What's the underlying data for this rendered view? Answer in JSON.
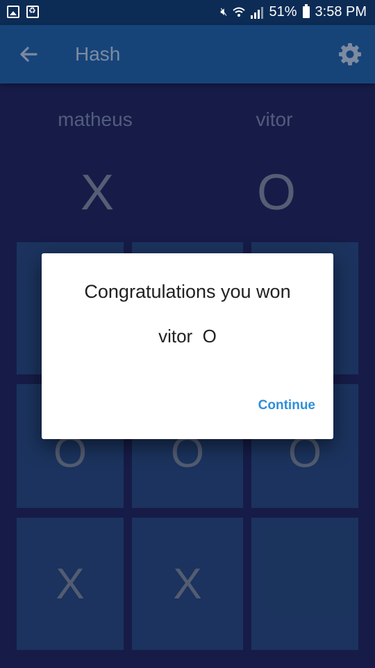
{
  "status_bar": {
    "time": "3:58 PM",
    "battery": "51%",
    "icons": [
      "image-icon",
      "package-icon",
      "mute-icon",
      "wifi-icon",
      "signal-icon",
      "battery-icon"
    ]
  },
  "app_bar": {
    "title": "Hash",
    "back_icon": "arrow-back-icon",
    "settings_icon": "gear-icon"
  },
  "players": [
    {
      "name": "matheus",
      "symbol": "X"
    },
    {
      "name": "vitor",
      "symbol": "O"
    }
  ],
  "board": {
    "cells": [
      "",
      "",
      "",
      "O",
      "O",
      "O",
      "X",
      "X",
      ""
    ]
  },
  "dialog": {
    "title": "Congratulations you won",
    "message": "vitor  O",
    "button": "Continue"
  },
  "colors": {
    "background": "#1b2254",
    "app_bar": "#164479",
    "cell": "#224273",
    "accent": "#2f8fd8"
  }
}
